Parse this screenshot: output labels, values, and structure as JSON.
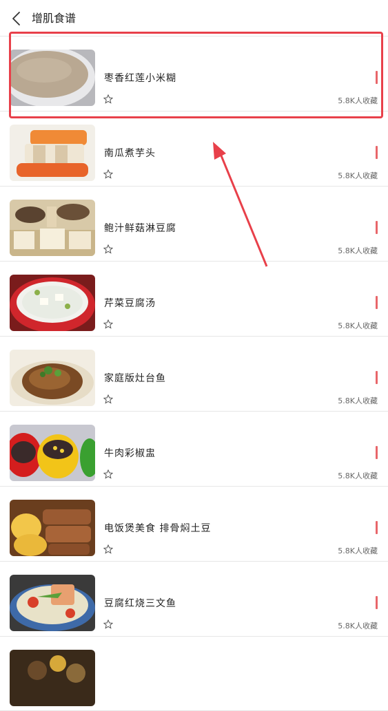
{
  "header": {
    "title": "增肌食谱",
    "back_icon": "back-arrow-icon"
  },
  "recipes": [
    {
      "name": "枣香红莲小米糊",
      "favorites": "5.8K人收藏"
    },
    {
      "name": "南瓜煮芋头",
      "favorites": "5.8K人收藏"
    },
    {
      "name": "鲍汁鲜菇淋豆腐",
      "favorites": "5.8K人收藏"
    },
    {
      "name": "芹菜豆腐汤",
      "favorites": "5.8K人收藏"
    },
    {
      "name": "家庭版灶台鱼",
      "favorites": "5.8K人收藏"
    },
    {
      "name": "牛肉彩椒盅",
      "favorites": "5.8K人收藏"
    },
    {
      "name": "电饭煲美食 排骨焖土豆",
      "favorites": "5.8K人收藏"
    },
    {
      "name": "豆腐红烧三文鱼",
      "favorites": "5.8K人收藏"
    }
  ],
  "colors": {
    "accent": "#e8666a",
    "highlight": "#e8404a"
  }
}
